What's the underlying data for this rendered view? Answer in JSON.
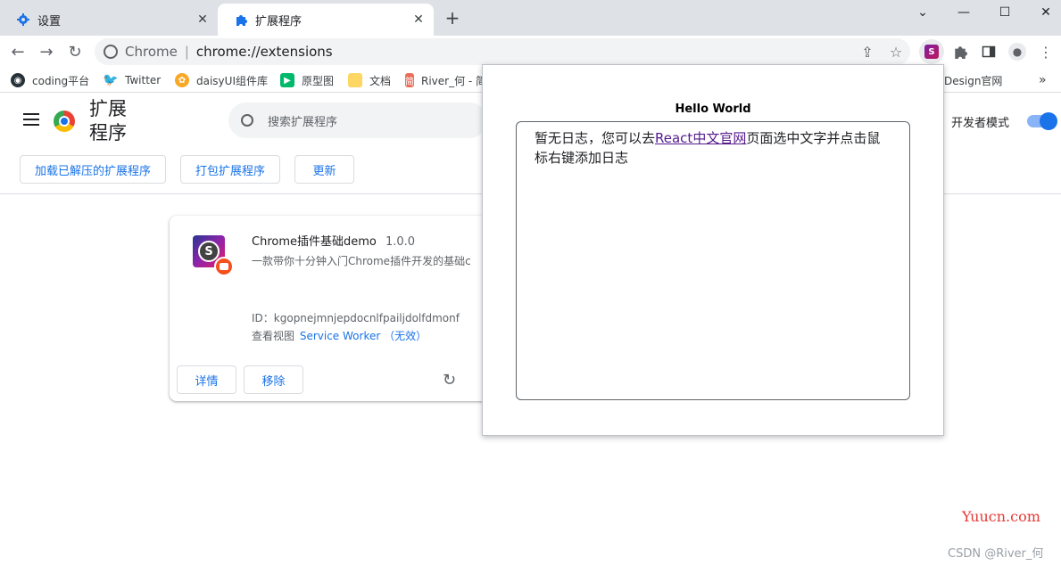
{
  "tabs": [
    {
      "label": "设置",
      "icon": "gear-icon"
    },
    {
      "label": "扩展程序",
      "icon": "puzzle-icon"
    }
  ],
  "toolbar": {
    "site_label": "Chrome",
    "url": "chrome://extensions"
  },
  "bookmarks": [
    {
      "label": "coding平台",
      "icon": "coding-icon"
    },
    {
      "label": "Twitter",
      "icon": "twitter-icon"
    },
    {
      "label": "daisyUI组件库",
      "icon": "flower-icon"
    },
    {
      "label": "原型图",
      "icon": "play-icon"
    },
    {
      "label": "文档",
      "icon": "folder-icon"
    },
    {
      "label": "River_何 - 简",
      "icon": "jianshu-icon"
    },
    {
      "label": "Design官网",
      "icon": "link-icon"
    }
  ],
  "extensions_page": {
    "title": "扩展程序",
    "search_placeholder": "搜索扩展程序",
    "dev_mode_label": "开发者模式",
    "dev_mode_on": true,
    "buttons": {
      "load_unpacked": "加载已解压的扩展程序",
      "pack": "打包扩展程序",
      "update": "更新"
    }
  },
  "extension_card": {
    "name": "Chrome插件基础demo",
    "version": "1.0.0",
    "description": "一款带你十分钟入门Chrome插件开发的基础c",
    "id_label": "ID：",
    "id": "kgopnejmnjepdocnlfpailjdolfdmonf",
    "view_label": "查看视图",
    "view_link": "Service Worker",
    "view_status": "（无效）",
    "details_button": "详情",
    "remove_button": "移除"
  },
  "popup": {
    "title": "Hello World",
    "log_prefix": "暂无日志，您可以去",
    "log_link": "React中文官网",
    "log_suffix": "页面选中文字并点击鼠标右键添加日志"
  },
  "watermarks": {
    "site": "Yuucn.com",
    "author": "CSDN @River_何"
  },
  "colors": {
    "accent": "#1a73e8",
    "tabstrip": "#dee1e6",
    "link_visited": "#551a8b"
  }
}
